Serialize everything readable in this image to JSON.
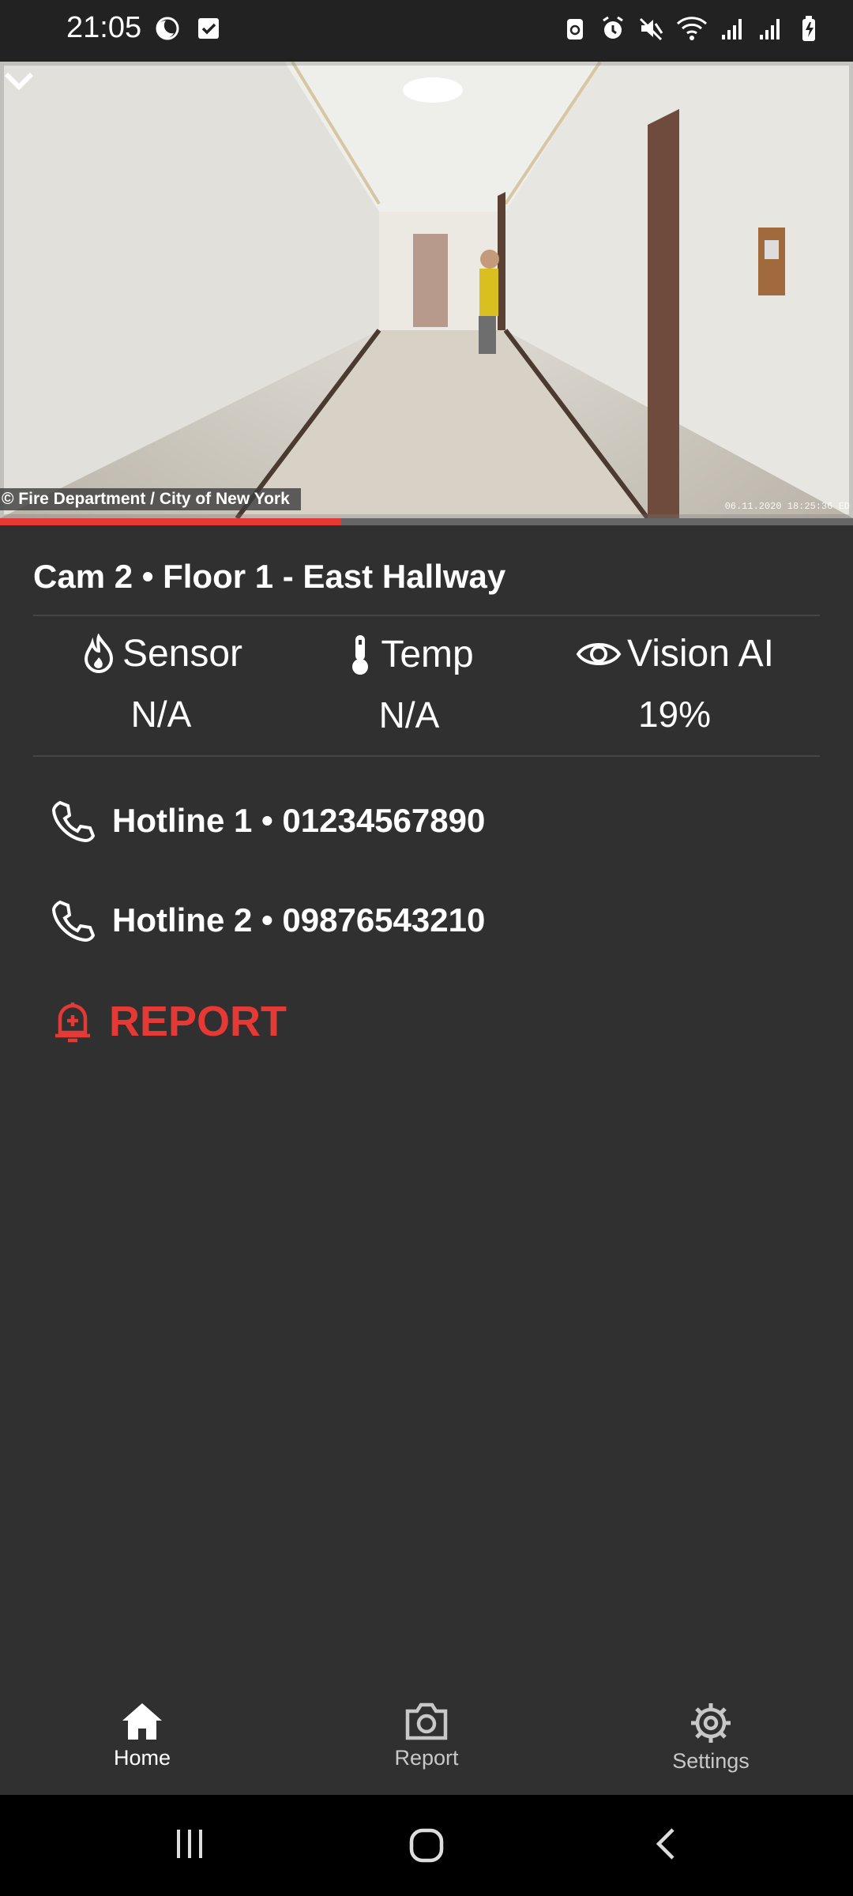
{
  "status_bar": {
    "time": "21:05"
  },
  "camera": {
    "credit": "© Fire Department / City of New York",
    "timestamp": "06.11.2020 18:25:36 ED",
    "title": "Cam 2 • Floor 1 - East Hallway",
    "playback_progress": 0.4
  },
  "stats": [
    {
      "label": "Sensor",
      "value": "N/A",
      "icon": "flame-icon"
    },
    {
      "label": "Temp",
      "value": "N/A",
      "icon": "thermometer-icon"
    },
    {
      "label": "Vision AI",
      "value": "19%",
      "icon": "eye-icon"
    }
  ],
  "hotlines": [
    {
      "label": "Hotline 1 • 01234567890",
      "icon": "phone-icon"
    },
    {
      "label": "Hotline 2 • 09876543210",
      "icon": "phone-icon"
    }
  ],
  "report": {
    "label": "REPORT",
    "icon": "alarm-bell-icon",
    "color": "#e53935"
  },
  "bottom_nav": [
    {
      "label": "Home",
      "icon": "home-icon",
      "active": true
    },
    {
      "label": "Report",
      "icon": "camera-icon",
      "active": false
    },
    {
      "label": "Settings",
      "icon": "gear-icon",
      "active": false
    }
  ],
  "colors": {
    "background": "#303030",
    "accent": "#e53935",
    "status_bar": "#222222"
  }
}
